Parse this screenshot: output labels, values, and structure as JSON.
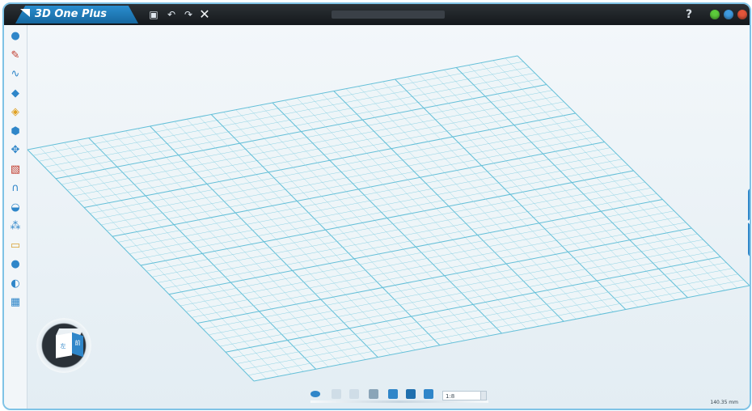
{
  "titlebar": {
    "app_title": "3D One Plus",
    "icons": [
      "save-icon",
      "undo-icon",
      "redo-icon",
      "close-doc-icon"
    ],
    "help_label": "?",
    "window_buttons": {
      "minimize_color": "#5ccb3b",
      "maximize_color": "#3f9be0",
      "close_color": "#e4553a"
    }
  },
  "left_toolbar": {
    "tools": [
      {
        "name": "basic-solid-icon",
        "color": "#2f86c9"
      },
      {
        "name": "sketch-pen-icon",
        "color": "#c0392b"
      },
      {
        "name": "curve-icon",
        "color": "#2f86c9"
      },
      {
        "name": "feature-icon",
        "color": "#2f86c9"
      },
      {
        "name": "special-function-icon",
        "color": "#e0a020"
      },
      {
        "name": "modify-icon",
        "color": "#2f86c9"
      },
      {
        "name": "move-icon",
        "color": "#2f86c9"
      },
      {
        "name": "pattern-icon",
        "color": "#c0392b"
      },
      {
        "name": "magnet-icon",
        "color": "#2f86c9"
      },
      {
        "name": "assembly-icon",
        "color": "#2f86c9"
      },
      {
        "name": "combine-icon",
        "color": "#2f86c9"
      },
      {
        "name": "measure-icon",
        "color": "#d9a030"
      },
      {
        "name": "material-sphere-icon",
        "color": "#2f86c9"
      },
      {
        "name": "render-icon",
        "color": "#2f86c9"
      },
      {
        "name": "grid-settings-icon",
        "color": "#2f86c9"
      }
    ]
  },
  "view_cube": {
    "label_side": "前",
    "label_front": "左"
  },
  "bottom_toolbar": {
    "icons": [
      "view-eye-icon",
      "fit-view-icon",
      "zoom-window-icon",
      "zoom-icon",
      "render-mode-icon",
      "display-mode-icon",
      "view-direction-icon"
    ],
    "view_select_value": "1:8"
  },
  "status": {
    "text": "140.35 mm"
  },
  "colors": {
    "accent": "#2f86c9",
    "grid_line": "#8fd3e4",
    "grid_major": "#63bfd8"
  }
}
